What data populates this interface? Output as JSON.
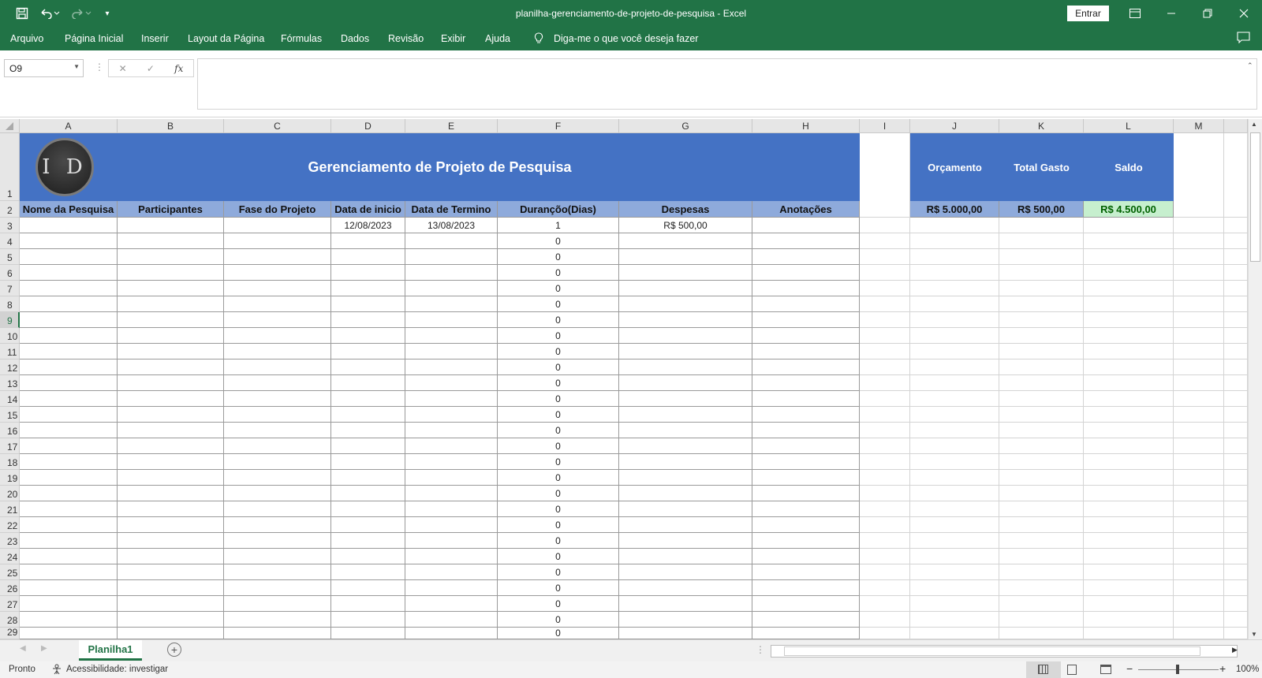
{
  "app": {
    "title": "planilha-gerenciamento-de-projeto-de-pesquisa  -  Excel",
    "signin": "Entrar"
  },
  "ribbon": {
    "tabs": [
      "Arquivo",
      "Página Inicial",
      "Inserir",
      "Layout da Página",
      "Fórmulas",
      "Dados",
      "Revisão",
      "Exibir",
      "Ajuda"
    ],
    "tell_me": "Diga-me o que você deseja fazer"
  },
  "formula_bar": {
    "name_box": "O9",
    "fx": "fx",
    "value": ""
  },
  "columns": [
    "A",
    "B",
    "C",
    "D",
    "E",
    "F",
    "G",
    "H",
    "I",
    "J",
    "K",
    "L",
    "M"
  ],
  "sheet": {
    "logo_text": "I D",
    "title": "Gerenciamento de Projeto de Pesquisa",
    "headers": [
      "Nome da Pesquisa",
      "Participantes",
      "Fase do Projeto",
      "Data de inicio",
      "Data de Termino",
      "Durançõo(Dias)",
      "Despesas",
      "Anotações"
    ],
    "row3": {
      "start": "12/08/2023",
      "end": "13/08/2023",
      "duration": "1",
      "expense": "R$ 500,00"
    },
    "durations_rest": "0",
    "summary_labels": [
      "Orçamento",
      "Total Gasto",
      "Saldo"
    ],
    "summary_values": [
      "R$ 5.000,00",
      "R$ 500,00",
      "R$ 4.500,00"
    ],
    "summary_colors": {
      "header": "#4472c4",
      "values": "#8eaadb",
      "saldo": "#c6efce",
      "saldo_text": "#006100"
    }
  },
  "sheet_tab": "Planilha1",
  "status": {
    "ready": "Pronto",
    "accessibility": "Acessibilidade: investigar",
    "zoom": "100%"
  }
}
